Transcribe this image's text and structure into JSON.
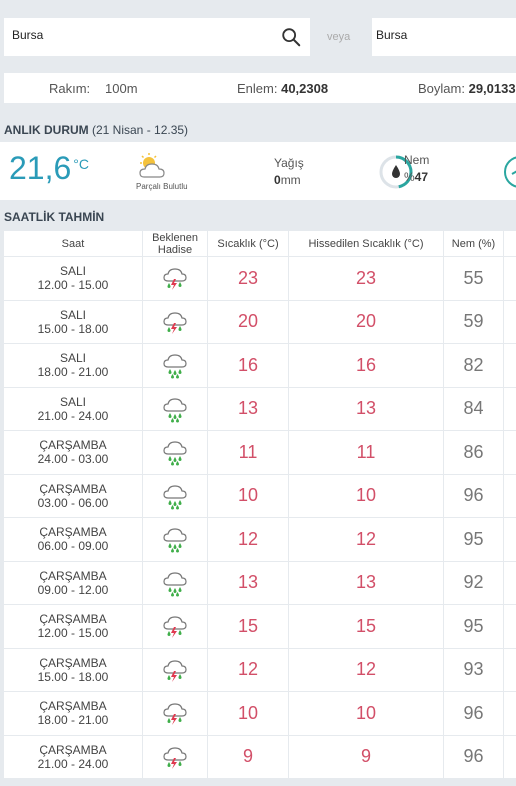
{
  "search": {
    "city_value": "Bursa",
    "or_label": "veya",
    "district_value": "Bursa"
  },
  "location": {
    "altitude_label": "Rakım:",
    "altitude_value": "100m",
    "lat_label": "Enlem:",
    "lat_value": "40,2308",
    "lon_label": "Boylam:",
    "lon_value": "29,0133"
  },
  "current": {
    "title": "ANLIK DURUM",
    "timestamp": "(21 Nisan - 12.35)",
    "temperature": "21,6",
    "temp_unit": "°C",
    "condition": "Parçalı Bulutlu",
    "rain_label": "Yağış",
    "rain_value": "0",
    "rain_unit": "mm",
    "humidity_label": "Nem",
    "humidity_prefix": "%",
    "humidity_value": "47",
    "humidity_fraction": 0.47
  },
  "hourly": {
    "title": "SAATLİK TAHMİN",
    "headers": {
      "time": "Saat",
      "event_line1": "Beklenen",
      "event_line2": "Hadise",
      "temp": "Sıcaklık (°C)",
      "feels": "Hissedilen Sıcaklık (°C)",
      "humidity": "Nem (%)"
    },
    "rows": [
      {
        "day": "SALI",
        "range": "12.00 - 15.00",
        "icon": "thunderstorm-icon",
        "temp": "23",
        "feels": "23",
        "humidity": "55"
      },
      {
        "day": "SALI",
        "range": "15.00 - 18.00",
        "icon": "thunderstorm-icon",
        "temp": "20",
        "feels": "20",
        "humidity": "59"
      },
      {
        "day": "SALI",
        "range": "18.00 - 21.00",
        "icon": "rain-icon",
        "temp": "16",
        "feels": "16",
        "humidity": "82"
      },
      {
        "day": "SALI",
        "range": "21.00 - 24.00",
        "icon": "rain-icon",
        "temp": "13",
        "feels": "13",
        "humidity": "84"
      },
      {
        "day": "ÇARŞAMBA",
        "range": "24.00 - 03.00",
        "icon": "rain-icon",
        "temp": "11",
        "feels": "11",
        "humidity": "86"
      },
      {
        "day": "ÇARŞAMBA",
        "range": "03.00 - 06.00",
        "icon": "rain-icon",
        "temp": "10",
        "feels": "10",
        "humidity": "96"
      },
      {
        "day": "ÇARŞAMBA",
        "range": "06.00 - 09.00",
        "icon": "rain-icon",
        "temp": "12",
        "feels": "12",
        "humidity": "95"
      },
      {
        "day": "ÇARŞAMBA",
        "range": "09.00 - 12.00",
        "icon": "rain-icon",
        "temp": "13",
        "feels": "13",
        "humidity": "92"
      },
      {
        "day": "ÇARŞAMBA",
        "range": "12.00 - 15.00",
        "icon": "thunderstorm-icon",
        "temp": "15",
        "feels": "15",
        "humidity": "95"
      },
      {
        "day": "ÇARŞAMBA",
        "range": "15.00 - 18.00",
        "icon": "thunderstorm-icon",
        "temp": "12",
        "feels": "12",
        "humidity": "93"
      },
      {
        "day": "ÇARŞAMBA",
        "range": "18.00 - 21.00",
        "icon": "thunderstorm-icon",
        "temp": "10",
        "feels": "10",
        "humidity": "96"
      },
      {
        "day": "ÇARŞAMBA",
        "range": "21.00 - 24.00",
        "icon": "thunderstorm-icon",
        "temp": "9",
        "feels": "9",
        "humidity": "96"
      }
    ]
  }
}
